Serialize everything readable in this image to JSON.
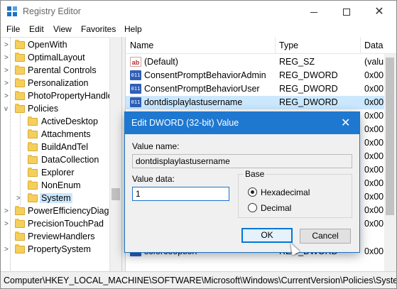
{
  "window": {
    "title": "Registry Editor",
    "min_glyph": "",
    "close_glyph": "✕"
  },
  "menu": [
    "File",
    "Edit",
    "View",
    "Favorites",
    "Help"
  ],
  "tree": {
    "items": [
      {
        "label": "OpenWith",
        "expand": ">"
      },
      {
        "label": "OptimalLayout",
        "expand": ">"
      },
      {
        "label": "Parental Controls",
        "expand": ">"
      },
      {
        "label": "Personalization",
        "expand": ">"
      },
      {
        "label": "PhotoPropertyHandle",
        "expand": ">"
      },
      {
        "label": "Policies",
        "expand": "v"
      },
      {
        "label": "ActiveDesktop",
        "expand": ""
      },
      {
        "label": "Attachments",
        "expand": ""
      },
      {
        "label": "BuildAndTel",
        "expand": ""
      },
      {
        "label": "DataCollection",
        "expand": ""
      },
      {
        "label": "Explorer",
        "expand": ""
      },
      {
        "label": "NonEnum",
        "expand": ""
      },
      {
        "label": "System",
        "expand": ">"
      },
      {
        "label": "PowerEfficiencyDiagn",
        "expand": ">"
      },
      {
        "label": "PrecisionTouchPad",
        "expand": ">"
      },
      {
        "label": "PreviewHandlers",
        "expand": ""
      },
      {
        "label": "PropertySystem",
        "expand": ">"
      }
    ]
  },
  "list": {
    "headers": {
      "name": "Name",
      "type": "Type",
      "data": "Data"
    },
    "rows": [
      {
        "icon": "ab",
        "name": "(Default)",
        "type": "REG_SZ",
        "data": "(valu"
      },
      {
        "icon": "011",
        "name": "ConsentPromptBehaviorAdmin",
        "type": "REG_DWORD",
        "data": "0x00"
      },
      {
        "icon": "011",
        "name": "ConsentPromptBehaviorUser",
        "type": "REG_DWORD",
        "data": "0x00"
      },
      {
        "icon": "011",
        "name": "dontdisplaylastusername",
        "type": "REG_DWORD",
        "data": "0x00"
      }
    ],
    "hidden_data": [
      "0x00",
      "0x00",
      "0x00",
      "0x00",
      "0x00",
      "0x00",
      "0x00",
      "0x00",
      "0x00"
    ],
    "partial_row": {
      "name": "scforceoption",
      "type": "REG_DWORD",
      "data": "0x00"
    }
  },
  "status": {
    "path": "Computer\\HKEY_LOCAL_MACHINE\\SOFTWARE\\Microsoft\\Windows\\CurrentVersion\\Policies\\System"
  },
  "dialog": {
    "title": "Edit DWORD (32-bit) Value",
    "close_glyph": "✕",
    "value_name_label": "Value name:",
    "value_name": "dontdisplaylastusername",
    "value_data_label": "Value data:",
    "value_data": "1",
    "base_label": "Base",
    "base_options": [
      {
        "label": "Hexadecimal",
        "selected": true
      },
      {
        "label": "Decimal",
        "selected": false
      }
    ],
    "ok_label": "OK",
    "cancel_label": "Cancel"
  },
  "colors": {
    "accent": "#1f78d0",
    "selection": "#cce8ff"
  }
}
